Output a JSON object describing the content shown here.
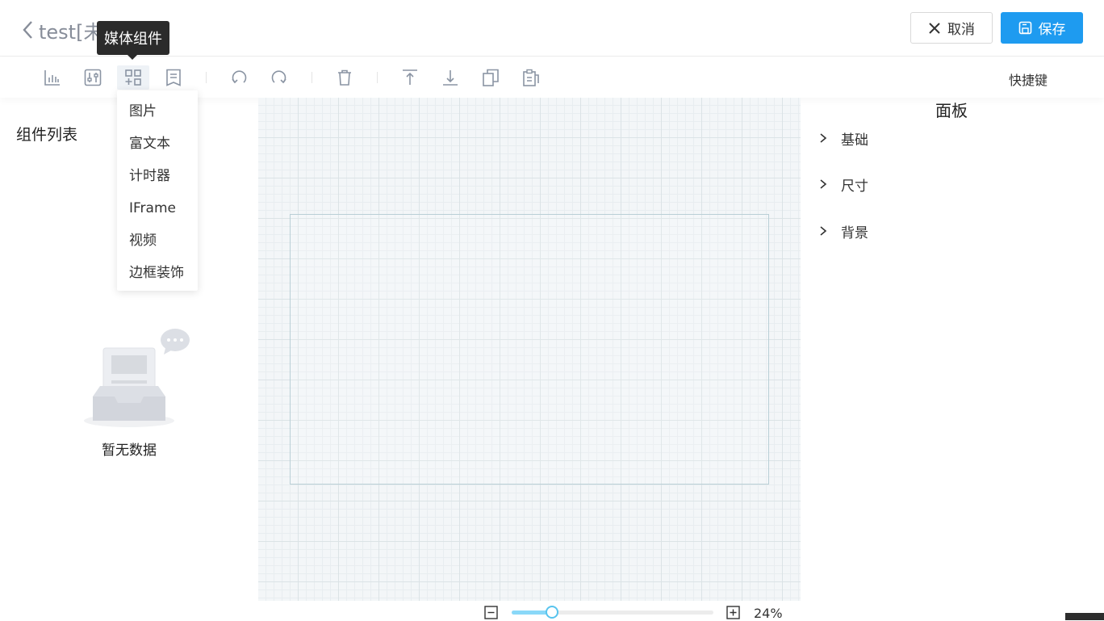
{
  "header": {
    "back_title": "test[未发布]",
    "cancel_label": "取消",
    "save_label": "保存"
  },
  "tooltip": "媒体组件",
  "toolbar": {
    "icons": [
      "chart-icon",
      "controls-icon",
      "media-components-icon",
      "document-icon",
      "undo-icon",
      "redo-icon",
      "delete-icon",
      "move-top-icon",
      "move-bottom-icon",
      "copy-icon",
      "paste-icon"
    ],
    "shortcut_label": "快捷键"
  },
  "dropdown": {
    "items": [
      "图片",
      "富文本",
      "计时器",
      "IFrame",
      "视频",
      "边框装饰"
    ]
  },
  "left_panel": {
    "title": "组件列表",
    "empty_text": "暂无数据"
  },
  "canvas": {
    "zoom_text": "24%",
    "zoom_fraction": 0.2
  },
  "right_panel": {
    "title": "面板",
    "sections": [
      "基础",
      "尺寸",
      "背景"
    ]
  },
  "colors": {
    "primary": "#1e9bf0",
    "slider": "#58c4ee"
  }
}
